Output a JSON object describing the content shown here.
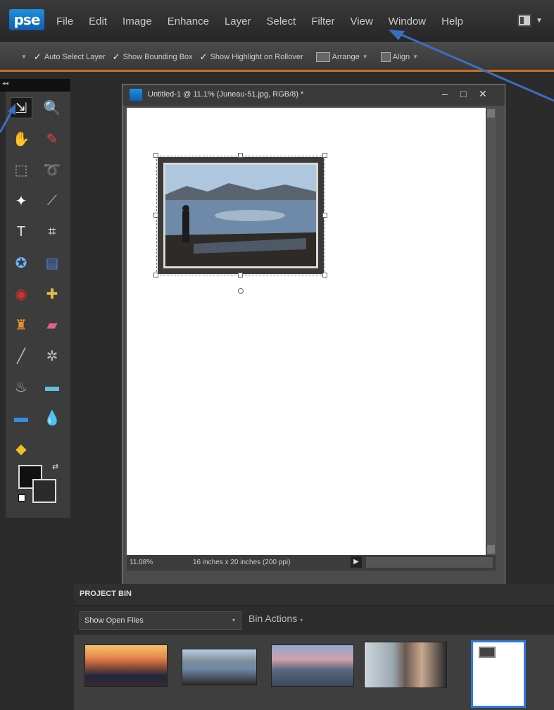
{
  "app": {
    "logo_text": "pse"
  },
  "menu": [
    "File",
    "Edit",
    "Image",
    "Enhance",
    "Layer",
    "Select",
    "Filter",
    "View",
    "Window",
    "Help"
  ],
  "options_bar": {
    "auto_select_layer": "Auto Select Layer",
    "show_bounding_box": "Show Bounding Box",
    "show_highlight": "Show Highlight on Rollover",
    "arrange": "Arrange",
    "align": "Align"
  },
  "toolbox": {
    "collapse_glyph": "◂◂",
    "tools": [
      {
        "name": "move-tool",
        "glyph": "⇲",
        "color": "#eeeeee"
      },
      {
        "name": "zoom-tool",
        "glyph": "🔍",
        "color": "#7fb3ff"
      },
      {
        "name": "hand-tool",
        "glyph": "✋",
        "color": "#eeeeee"
      },
      {
        "name": "eyedropper-tool",
        "glyph": "✎",
        "color": "#e04a4a"
      },
      {
        "name": "marquee-tool",
        "glyph": "⬚",
        "color": "#bbbbbb"
      },
      {
        "name": "lasso-tool",
        "glyph": "➰",
        "color": "#e6a817"
      },
      {
        "name": "magic-wand-tool",
        "glyph": "✦",
        "color": "#ffffff"
      },
      {
        "name": "quick-selection-tool",
        "glyph": "⟋",
        "color": "#bbbbbb"
      },
      {
        "name": "type-tool",
        "glyph": "T",
        "color": "#dddddd"
      },
      {
        "name": "crop-tool",
        "glyph": "⌗",
        "color": "#dddddd"
      },
      {
        "name": "cookie-cutter-tool",
        "glyph": "✪",
        "color": "#6fb6ff"
      },
      {
        "name": "straighten-tool",
        "glyph": "▤",
        "color": "#4f7fe0"
      },
      {
        "name": "red-eye-tool",
        "glyph": "◉",
        "color": "#d03030"
      },
      {
        "name": "healing-brush-tool",
        "glyph": "✚",
        "color": "#e0c040"
      },
      {
        "name": "clone-stamp-tool",
        "glyph": "♜",
        "color": "#e8902a"
      },
      {
        "name": "eraser-tool",
        "glyph": "▰",
        "color": "#e06090"
      },
      {
        "name": "brush-tool",
        "glyph": "╱",
        "color": "#bbbbbb"
      },
      {
        "name": "smart-brush-tool",
        "glyph": "✲",
        "color": "#bbbbbb"
      },
      {
        "name": "paint-bucket-tool",
        "glyph": "♨",
        "color": "#bbbbbb"
      },
      {
        "name": "gradient-tool",
        "glyph": "▬",
        "color": "#60c0e0"
      },
      {
        "name": "shape-tool",
        "glyph": "▬",
        "color": "#3a8ae0"
      },
      {
        "name": "blur-tool",
        "glyph": "💧",
        "color": "#3a8ae0"
      },
      {
        "name": "sponge-tool",
        "glyph": "◆",
        "color": "#f0c020"
      }
    ],
    "swap_glyph": "⇄"
  },
  "document": {
    "title": "Untitled-1 @ 11.1% (Juneau-51.jpg, RGB/8) *",
    "minimize": "–",
    "maximize": "□",
    "close": "✕",
    "zoom_percent": "11.08%",
    "dimensions": "16 inches x 20 inches (200 ppi)",
    "play_glyph": "▶"
  },
  "project_bin": {
    "title": "PROJECT BIN",
    "show_select": "Show Open Files",
    "bin_actions": "Bin Actions",
    "select_caret": "▾",
    "thumbnails": [
      "sunset",
      "lake-fisherman",
      "mountains-dusk",
      "couple-glacier",
      "untitled-document"
    ]
  },
  "colors": {
    "accent_orange": "#d06a1b",
    "selection_blue": "#2c7ae0",
    "arrow_blue": "#3a6fc0"
  }
}
